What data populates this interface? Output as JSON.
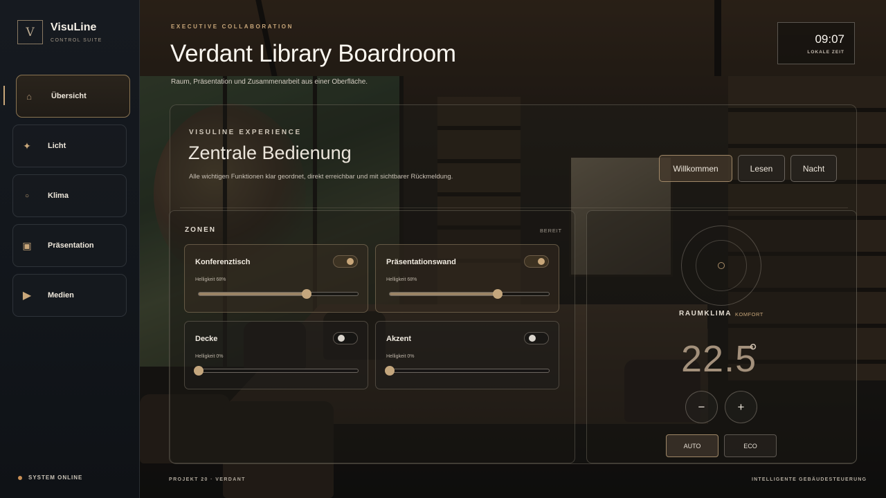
{
  "sidebar": {
    "logo_letter": "V",
    "brand": "VisuLine",
    "brand_sub": "CONTROL SUITE",
    "items": [
      {
        "label": "Übersicht",
        "icon": "home-icon"
      },
      {
        "label": "Licht",
        "icon": "sparkle-icon"
      },
      {
        "label": "Klima",
        "icon": "circle-icon"
      },
      {
        "label": "Präsentation",
        "icon": "screen-icon"
      },
      {
        "label": "Medien",
        "icon": "play-icon"
      }
    ],
    "active_item": "Übersicht",
    "status": "SYSTEM ONLINE"
  },
  "header": {
    "eyebrow": "EXECUTIVE COLLABORATION",
    "title": "Verdant Library Boardroom",
    "subtitle": "Raum, Präsentation und Zusammenarbeit aus einer Oberfläche.",
    "clock_time": "09:07",
    "clock_label": "LOKALE ZEIT"
  },
  "experience": {
    "eyebrow": "VISULINE EXPERIENCE",
    "title": "Zentrale Bedienung",
    "description": "Alle wichtigen Funktionen klar geordnet, direkt erreichbar und mit sichtbarer Rückmeldung.",
    "scenes": [
      "Willkommen",
      "Lesen",
      "Nacht"
    ],
    "active_scene": "Willkommen"
  },
  "zones": {
    "title": "ZONEN",
    "status": "BEREIT",
    "items": [
      {
        "name": "Konferenztisch",
        "brightness_label": "Helligkeit 68%",
        "on": true,
        "level": 0.68
      },
      {
        "name": "Präsentationswand",
        "brightness_label": "Helligkeit 68%",
        "on": true,
        "level": 0.68
      },
      {
        "name": "Decke",
        "brightness_label": "Helligkeit 0%",
        "on": false,
        "level": 0
      },
      {
        "name": "Akzent",
        "brightness_label": "Helligkeit 0%",
        "on": false,
        "level": 0
      }
    ]
  },
  "climate": {
    "title": "RAUMKLIMA",
    "mode_label": "KOMFORT",
    "temperature": "22.5",
    "unit": "°",
    "minus": "−",
    "plus": "+",
    "modes": [
      "AUTO",
      "ECO"
    ],
    "active_mode": "AUTO"
  },
  "footer": {
    "left": "PROJEKT 20 · VERDANT",
    "right": "INTELLIGENTE GEBÄUDESTEUERUNG"
  },
  "colors": {
    "accent": "#c9a77a",
    "sidebar_bg": "#161a20",
    "text": "#e8e2d8"
  }
}
